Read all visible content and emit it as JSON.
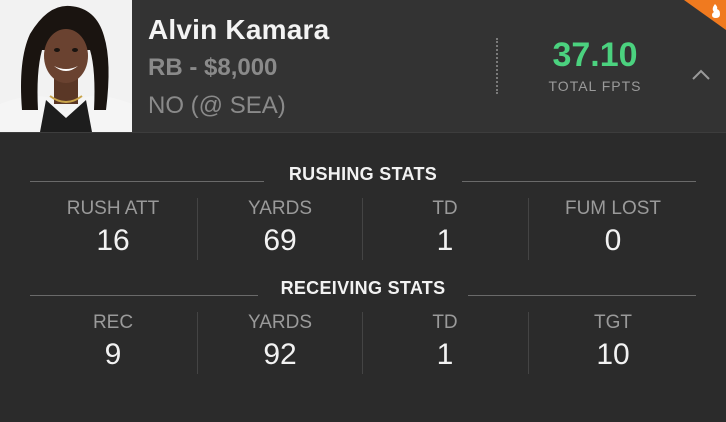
{
  "player": {
    "name": "Alvin Kamara",
    "position_salary": "RB - $8,000",
    "matchup": "NO (@ SEA)",
    "fpts_value": "37.10",
    "fpts_label": "TOTAL FPTS"
  },
  "colors": {
    "accent_green": "#4bd27f",
    "badge_orange": "#f07a1f"
  },
  "icons": {
    "collapse": "chevron-up-icon",
    "badge": "flame-icon"
  },
  "rushing": {
    "title": "RUSHING STATS",
    "stats": [
      {
        "label": "RUSH ATT",
        "value": "16"
      },
      {
        "label": "YARDS",
        "value": "69"
      },
      {
        "label": "TD",
        "value": "1"
      },
      {
        "label": "FUM LOST",
        "value": "0"
      }
    ]
  },
  "receiving": {
    "title": "RECEIVING STATS",
    "stats": [
      {
        "label": "REC",
        "value": "9"
      },
      {
        "label": "YARDS",
        "value": "92"
      },
      {
        "label": "TD",
        "value": "1"
      },
      {
        "label": "TGT",
        "value": "10"
      }
    ]
  }
}
